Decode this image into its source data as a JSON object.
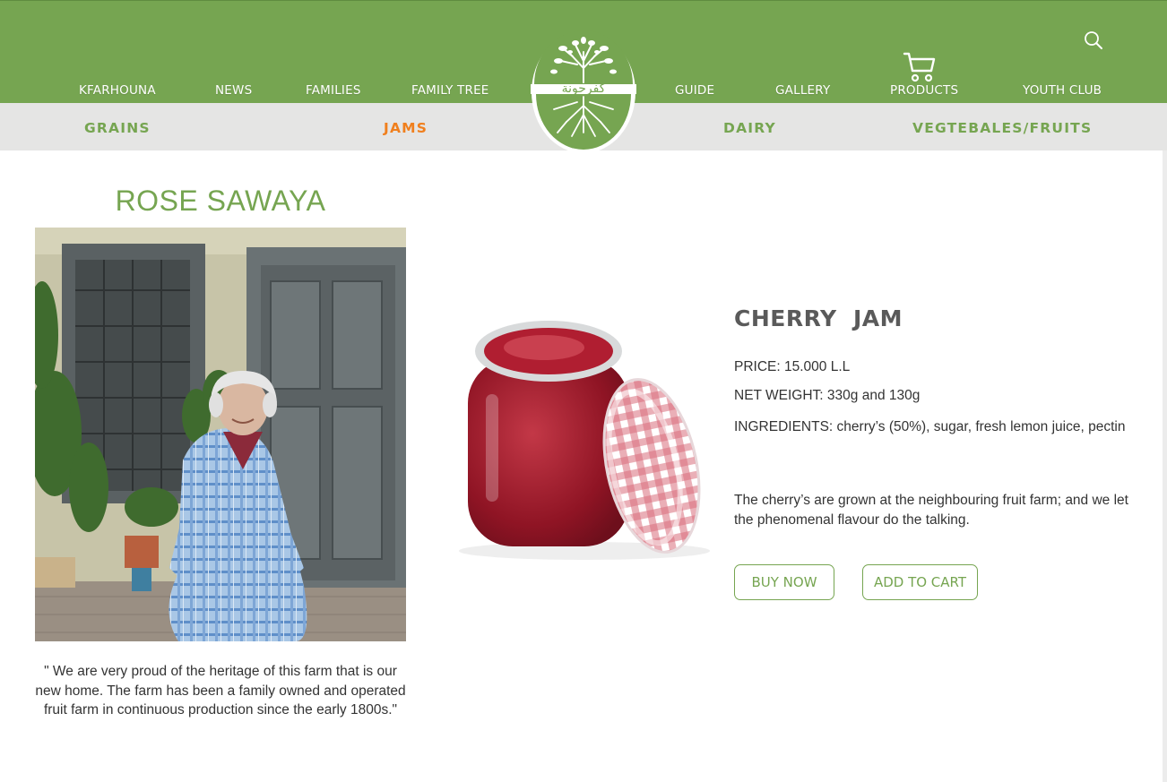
{
  "nav": {
    "items": [
      "KFARHOUNA",
      "NEWS",
      "FAMILIES",
      "FAMILY TREE",
      "GUIDE",
      "GALLERY",
      "PRODUCTS",
      "YOUTH CLUB"
    ]
  },
  "logo": {
    "arabic_text": "كفرحونة"
  },
  "categories": {
    "items": [
      "GRAINS",
      "JAMS",
      "DAIRY",
      "VEGTEBALES/FRUITS"
    ],
    "active": "JAMS",
    "active_color": "#f07f1d",
    "inactive_color": "#76a551"
  },
  "farmer": {
    "name": "ROSE SAWAYA",
    "quote": "\" We are very proud of the heritage of this farm that is our new home. The farm has been a family owned and operated fruit farm in continuous production since the early 1800s.\""
  },
  "product": {
    "title": "CHERRY  JAM",
    "price": "PRICE: 15.000 L.L",
    "net_weight": "NET WEIGHT: 330g and 130g",
    "ingredients": "INGREDIENTS: cherry’s (50%), sugar, fresh lemon juice, pectin",
    "description": "The cherry’s are grown at the neighbouring fruit farm; and we let the phenomenal flavour do the talking.",
    "buy_label": "BUY NOW",
    "cart_label": "ADD TO CART"
  },
  "colors": {
    "brand_green": "#76a551",
    "subbar_gray": "#e5e5e4",
    "accent_orange": "#f07f1d"
  }
}
